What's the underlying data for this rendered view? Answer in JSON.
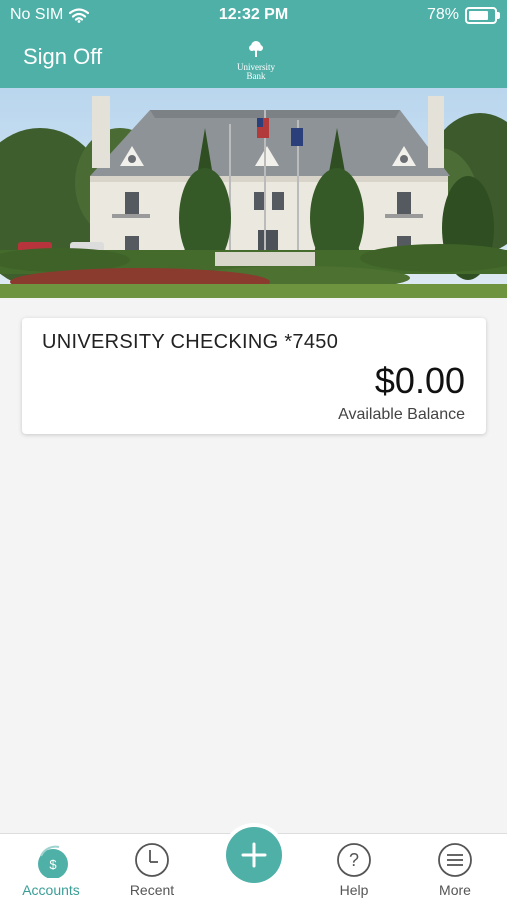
{
  "status_bar": {
    "carrier": "No SIM",
    "time": "12:32 PM",
    "battery_percent": "78%",
    "battery_level": 0.78,
    "wifi_icon": "wifi-icon",
    "battery_icon": "battery-icon"
  },
  "header": {
    "sign_off_label": "Sign Off",
    "logo_text_line1": "University",
    "logo_text_line2": "Bank",
    "brand_color": "#4fb0a8"
  },
  "account": {
    "name": "UNIVERSITY CHECKING *7450",
    "balance": "$0.00",
    "balance_label": "Available Balance"
  },
  "tabs": [
    {
      "label": "Accounts",
      "icon": "dollar-circle-icon",
      "active": true
    },
    {
      "label": "Recent",
      "icon": "clock-icon",
      "active": false
    },
    {
      "label": "",
      "icon": "plus-icon",
      "active": false
    },
    {
      "label": "Help",
      "icon": "question-circle-icon",
      "active": false
    },
    {
      "label": "More",
      "icon": "menu-lines-icon",
      "active": false
    }
  ]
}
